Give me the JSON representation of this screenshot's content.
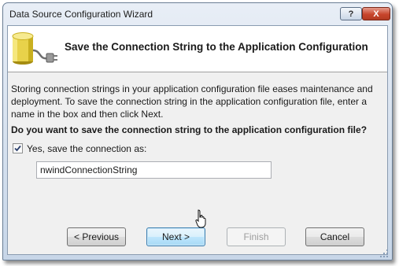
{
  "window": {
    "title": "Data Source Configuration Wizard",
    "help_label": "?",
    "close_label": "X"
  },
  "header": {
    "title": "Save the Connection String to the Application Configuration",
    "icon": "database-plug-icon"
  },
  "body": {
    "description": "Storing connection strings in your application configuration file eases maintenance and deployment. To save the connection string in the application configuration file, enter a name in the box and then click Next.",
    "question": "Do you want to save the connection string to the application configuration file?",
    "save_checkbox": {
      "label": "Yes, save the connection as:",
      "checked": true
    },
    "connection_name": {
      "value": "nwindConnectionString"
    }
  },
  "buttons": {
    "previous": "< Previous",
    "next": "Next >",
    "finish": "Finish",
    "cancel": "Cancel",
    "finish_enabled": false
  },
  "colors": {
    "accent_hover": "#bee6fd",
    "close_red": "#c8452c"
  }
}
